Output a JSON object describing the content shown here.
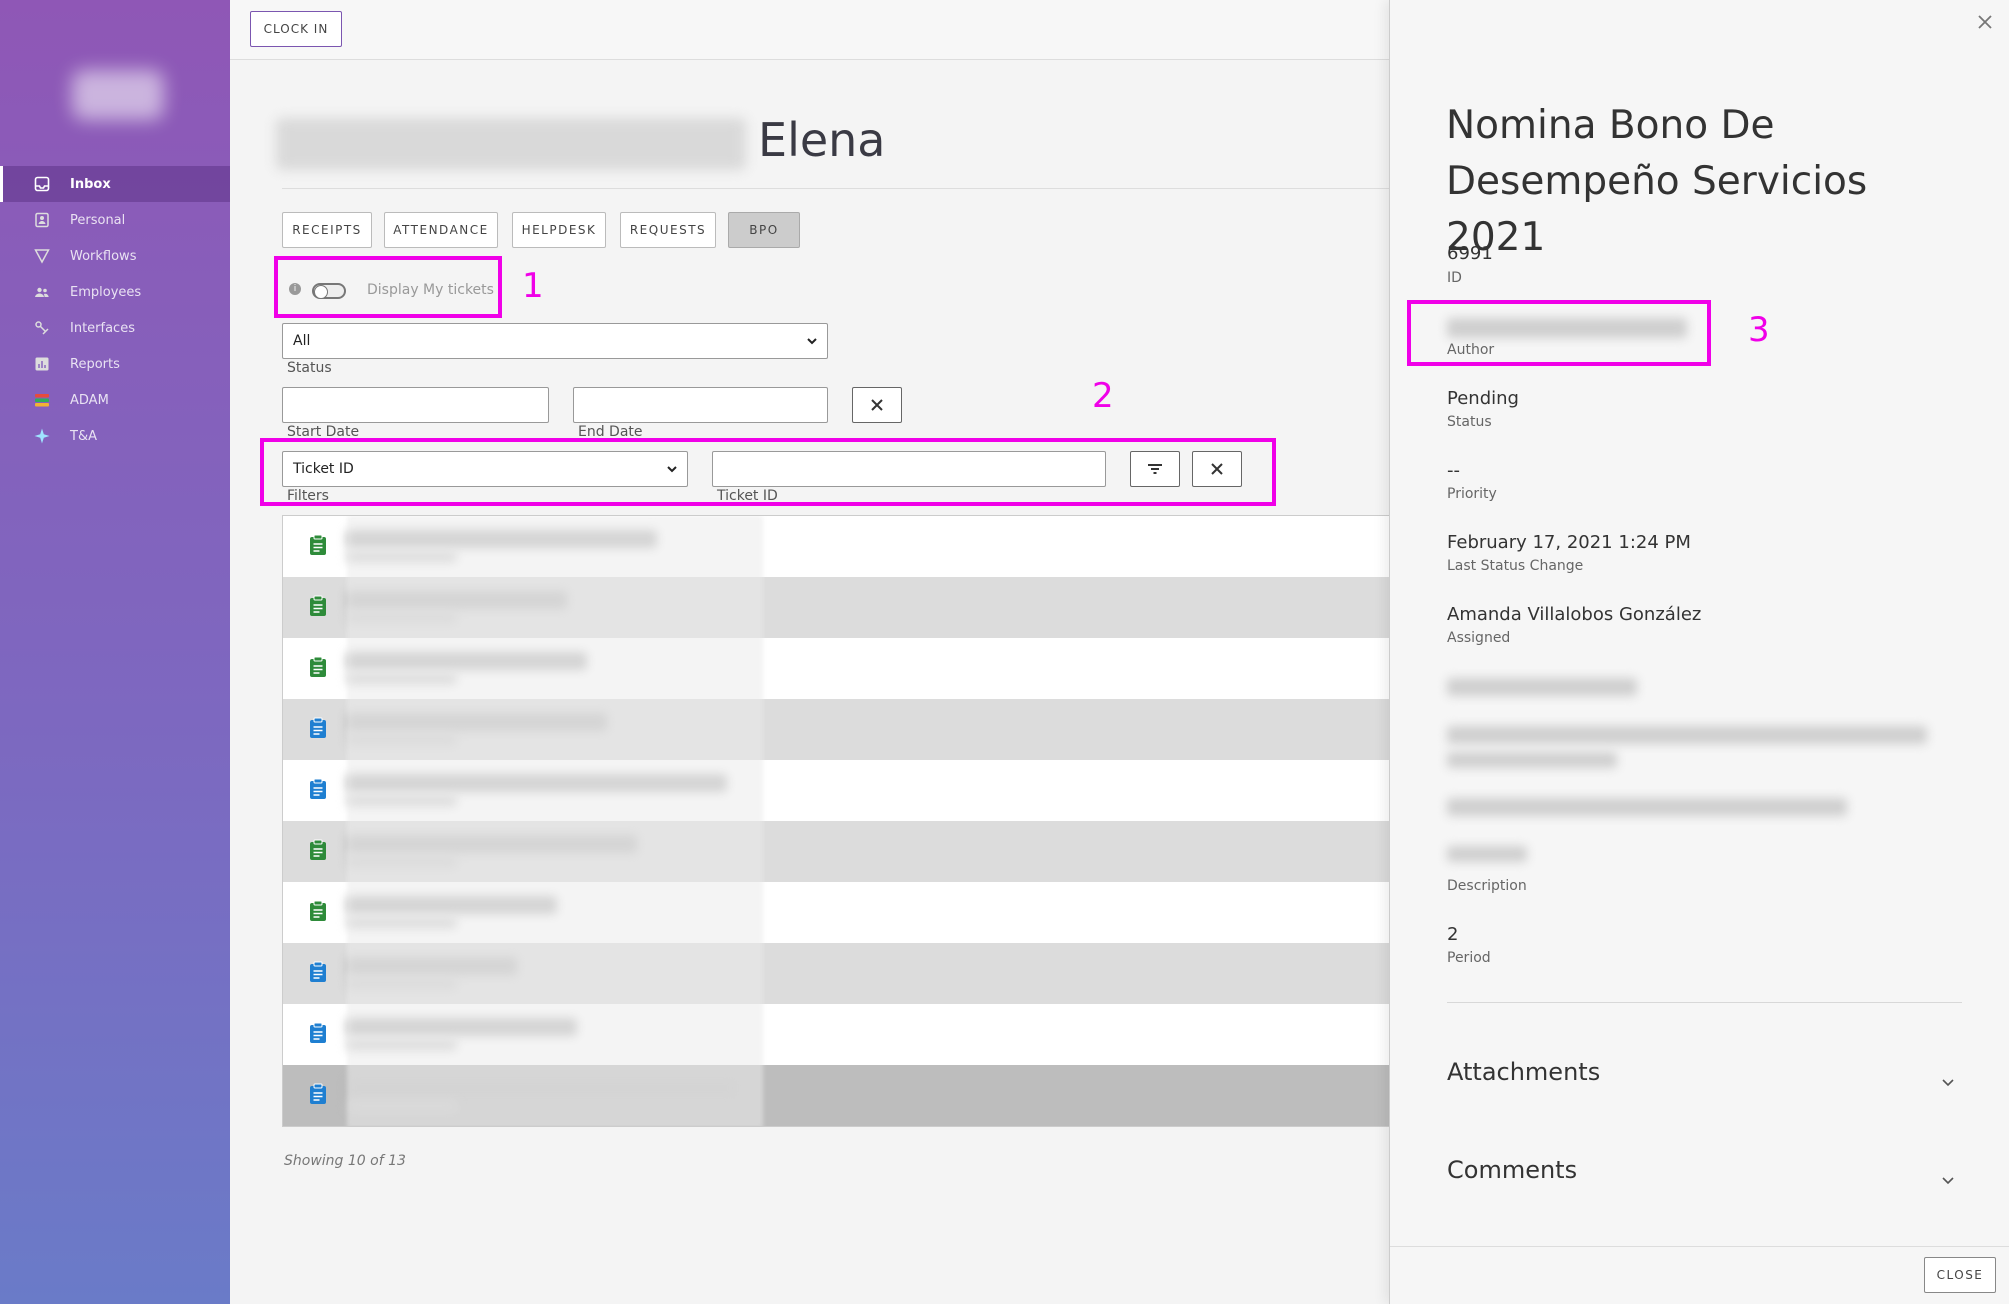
{
  "sidebar": {
    "items": [
      {
        "label": "Inbox",
        "icon": "inbox-icon",
        "active": true
      },
      {
        "label": "Personal",
        "icon": "person-card-icon"
      },
      {
        "label": "Workflows",
        "icon": "funnel-icon"
      },
      {
        "label": "Employees",
        "icon": "people-icon"
      },
      {
        "label": "Interfaces",
        "icon": "link-icon"
      },
      {
        "label": "Reports",
        "icon": "chart-icon"
      },
      {
        "label": "ADAM",
        "icon": "stack-icon"
      },
      {
        "label": "T&A",
        "icon": "sparkle-icon"
      }
    ]
  },
  "topbar": {
    "clock_in_label": "CLOCK IN"
  },
  "person": {
    "name_visible": "Elena"
  },
  "tabs": [
    {
      "label": "RECEIPTS"
    },
    {
      "label": "ATTENDANCE"
    },
    {
      "label": "HELPDESK"
    },
    {
      "label": "REQUESTS"
    },
    {
      "label": "BPO",
      "active": true
    }
  ],
  "toggle": {
    "label": "Display My tickets",
    "info": "i"
  },
  "filters": {
    "status_value": "All",
    "status_label": "Status",
    "start_date_label": "Start Date",
    "end_date_label": "End Date",
    "filter_value": "Ticket ID",
    "filter_label": "Filters",
    "ticket_id_label": "Ticket ID"
  },
  "annotations": {
    "one": "1",
    "two": "2",
    "three": "3"
  },
  "tickets": [
    {
      "color": "#2e8b3a"
    },
    {
      "color": "#2e8b3a"
    },
    {
      "color": "#2e8b3a"
    },
    {
      "color": "#1f7fd1"
    },
    {
      "color": "#1f7fd1"
    },
    {
      "color": "#2e8b3a"
    },
    {
      "color": "#2e8b3a"
    },
    {
      "color": "#1f7fd1"
    },
    {
      "color": "#1f7fd1"
    },
    {
      "color": "#1f7fd1"
    }
  ],
  "list_footer": "Showing 10 of 13",
  "panel": {
    "title": "Nomina Bono De Desempeño Servicios 2021",
    "id_value": "6991",
    "id_label": "ID",
    "author_label": "Author",
    "status_value": "Pending",
    "status_label": "Status",
    "priority_value": "--",
    "priority_label": "Priority",
    "last_change_value": "February 17, 2021 1:24 PM",
    "last_change_label": "Last Status Change",
    "assigned_value": "Amanda Villalobos González",
    "assigned_label": "Assigned",
    "description_label": "Description",
    "period_value": "2",
    "period_label": "Period",
    "attachments_label": "Attachments",
    "comments_label": "Comments",
    "close_label": "CLOSE"
  },
  "colors": {
    "accent": "#8f57b6",
    "highlight": "#f000e8"
  }
}
